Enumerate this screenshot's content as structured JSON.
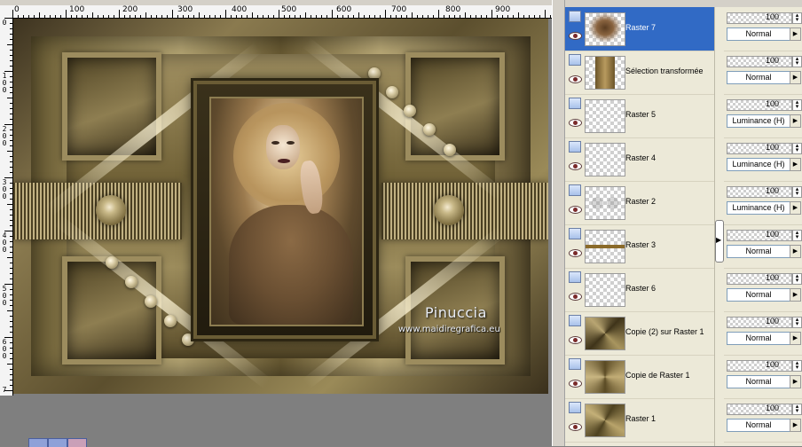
{
  "ruler": {
    "h_labels": [
      "0",
      "100",
      "200",
      "300",
      "400",
      "500",
      "600",
      "700",
      "800",
      "900"
    ],
    "v_labels": [
      [
        "0"
      ],
      [
        "1",
        "0",
        "0"
      ],
      [
        "2",
        "0",
        "0"
      ],
      [
        "3",
        "0",
        "0"
      ],
      [
        "4",
        "0",
        "0"
      ],
      [
        "5",
        "0",
        "0"
      ],
      [
        "6",
        "0",
        "0"
      ],
      [
        "7"
      ]
    ]
  },
  "canvas": {
    "watermark_name": "Pinuccia",
    "watermark_url": "www.maidiregrafica.eu"
  },
  "layers": [
    {
      "name": "Raster 7",
      "opacity": "100",
      "blend": "Normal",
      "selected": true,
      "thumb": "woman"
    },
    {
      "name": "Sélection transformée",
      "opacity": "100",
      "blend": "Normal",
      "selected": false,
      "thumb": "frame"
    },
    {
      "name": "Raster 5",
      "opacity": "100",
      "blend": "Luminance (H)",
      "selected": false,
      "thumb": "transparent"
    },
    {
      "name": "Raster 4",
      "opacity": "100",
      "blend": "Luminance (H)",
      "selected": false,
      "thumb": "transparent"
    },
    {
      "name": "Raster 2",
      "opacity": "100",
      "blend": "Luminance (H)",
      "selected": false,
      "thumb": "pattern"
    },
    {
      "name": "Raster 3",
      "opacity": "100",
      "blend": "Normal",
      "selected": false,
      "thumb": "dots"
    },
    {
      "name": "Raster 6",
      "opacity": "100",
      "blend": "Normal",
      "selected": false,
      "thumb": "transparent"
    },
    {
      "name": "Copie (2) sur Raster 1",
      "opacity": "100",
      "blend": "Normal",
      "selected": false,
      "thumb": "gold1"
    },
    {
      "name": "Copie de Raster 1",
      "opacity": "100",
      "blend": "Normal",
      "selected": false,
      "thumb": "gold2"
    },
    {
      "name": "Raster 1",
      "opacity": "100",
      "blend": "Normal",
      "selected": false,
      "thumb": "gold3"
    }
  ],
  "colors": {
    "selection": "#316ac5",
    "panel_bg": "#ece9d8",
    "gold_light": "#c2b283",
    "gold_dark": "#4a3f22"
  }
}
